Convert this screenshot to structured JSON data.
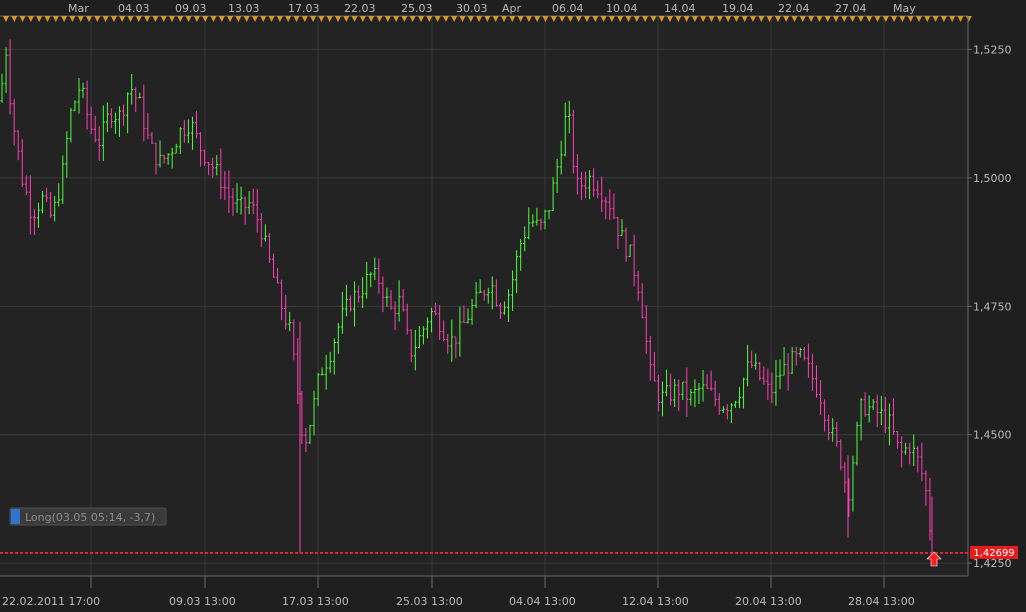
{
  "colors": {
    "background": "#1f1f1f",
    "plot_background": "#232323",
    "grid": "#3a3a3a",
    "up_bar": "#4cff3c",
    "down_bar": "#ff3fb4",
    "price_line": "#ff2a2a",
    "event_marker": "#d39a2a",
    "trade_box": "#3a3a3a",
    "trade_box_accent": "#2f74d0"
  },
  "top_axis_labels": [
    "Mar",
    "04.03",
    "09.03",
    "13.03",
    "17.03",
    "22.03",
    "25.03",
    "30.03",
    "Apr",
    "06.04",
    "10.04",
    "14.04",
    "19.04",
    "22.04",
    "27.04",
    "May"
  ],
  "trade_marker": {
    "label": "Long(03.05 05:14, -3,7)",
    "direction": "up",
    "arrow_icon": "up-arrow-icon"
  },
  "current_price_label": "1,42699",
  "chart_data": {
    "type": "bar",
    "instrument_kind": "OHLC price bars",
    "x_tick_labels": [
      "22.02.2011 17:00",
      "09.03 13:00",
      "17.03 13:00",
      "25.03 13:00",
      "04.04 13:00",
      "12.04 13:00",
      "20.04 13:00",
      "28.04 13:00"
    ],
    "y_tick_labels": [
      "1,5250",
      "1,5000",
      "1,4750",
      "1,4500",
      "1,4250"
    ],
    "y_ticks": [
      1.525,
      1.5,
      1.475,
      1.45,
      1.425
    ],
    "ylim": [
      1.4225,
      1.5315
    ],
    "current_price": 1.42699,
    "grid": true,
    "path_points": [
      [
        0,
        1.515
      ],
      [
        6,
        1.525
      ],
      [
        12,
        1.512
      ],
      [
        22,
        1.5
      ],
      [
        32,
        1.493
      ],
      [
        42,
        1.496
      ],
      [
        52,
        1.492
      ],
      [
        62,
        1.5
      ],
      [
        70,
        1.512
      ],
      [
        80,
        1.518
      ],
      [
        90,
        1.51
      ],
      [
        100,
        1.507
      ],
      [
        110,
        1.513
      ],
      [
        120,
        1.512
      ],
      [
        130,
        1.518
      ],
      [
        140,
        1.514
      ],
      [
        150,
        1.506
      ],
      [
        160,
        1.503
      ],
      [
        170,
        1.505
      ],
      [
        180,
        1.509
      ],
      [
        190,
        1.511
      ],
      [
        200,
        1.506
      ],
      [
        210,
        1.503
      ],
      [
        220,
        1.5
      ],
      [
        230,
        1.496
      ],
      [
        240,
        1.494
      ],
      [
        250,
        1.495
      ],
      [
        260,
        1.491
      ],
      [
        270,
        1.483
      ],
      [
        280,
        1.476
      ],
      [
        290,
        1.47
      ],
      [
        298,
        1.458
      ],
      [
        304,
        1.448
      ],
      [
        312,
        1.454
      ],
      [
        320,
        1.462
      ],
      [
        330,
        1.466
      ],
      [
        340,
        1.472
      ],
      [
        350,
        1.476
      ],
      [
        360,
        1.478
      ],
      [
        370,
        1.481
      ],
      [
        380,
        1.48
      ],
      [
        390,
        1.474
      ],
      [
        400,
        1.476
      ],
      [
        410,
        1.466
      ],
      [
        420,
        1.469
      ],
      [
        430,
        1.474
      ],
      [
        440,
        1.472
      ],
      [
        450,
        1.468
      ],
      [
        460,
        1.47
      ],
      [
        470,
        1.474
      ],
      [
        480,
        1.477
      ],
      [
        490,
        1.48
      ],
      [
        500,
        1.475
      ],
      [
        510,
        1.478
      ],
      [
        520,
        1.487
      ],
      [
        530,
        1.492
      ],
      [
        540,
        1.49
      ],
      [
        550,
        1.495
      ],
      [
        560,
        1.505
      ],
      [
        566,
        1.512
      ],
      [
        570,
        1.51
      ],
      [
        576,
        1.498
      ],
      [
        590,
        1.5
      ],
      [
        600,
        1.498
      ],
      [
        610,
        1.495
      ],
      [
        620,
        1.489
      ],
      [
        630,
        1.485
      ],
      [
        640,
        1.478
      ],
      [
        650,
        1.462
      ],
      [
        660,
        1.457
      ],
      [
        670,
        1.458
      ],
      [
        680,
        1.459
      ],
      [
        690,
        1.457
      ],
      [
        700,
        1.459
      ],
      [
        710,
        1.458
      ],
      [
        720,
        1.456
      ],
      [
        730,
        1.456
      ],
      [
        740,
        1.459
      ],
      [
        750,
        1.464
      ],
      [
        760,
        1.461
      ],
      [
        770,
        1.458
      ],
      [
        780,
        1.462
      ],
      [
        790,
        1.464
      ],
      [
        800,
        1.465
      ],
      [
        810,
        1.462
      ],
      [
        820,
        1.458
      ],
      [
        830,
        1.451
      ],
      [
        840,
        1.446
      ],
      [
        848,
        1.438
      ],
      [
        855,
        1.448
      ],
      [
        862,
        1.456
      ],
      [
        870,
        1.455
      ],
      [
        880,
        1.454
      ],
      [
        890,
        1.452
      ],
      [
        900,
        1.446
      ],
      [
        910,
        1.448
      ],
      [
        920,
        1.444
      ],
      [
        928,
        1.437
      ],
      [
        932,
        1.427
      ]
    ],
    "bar_count": 230
  }
}
